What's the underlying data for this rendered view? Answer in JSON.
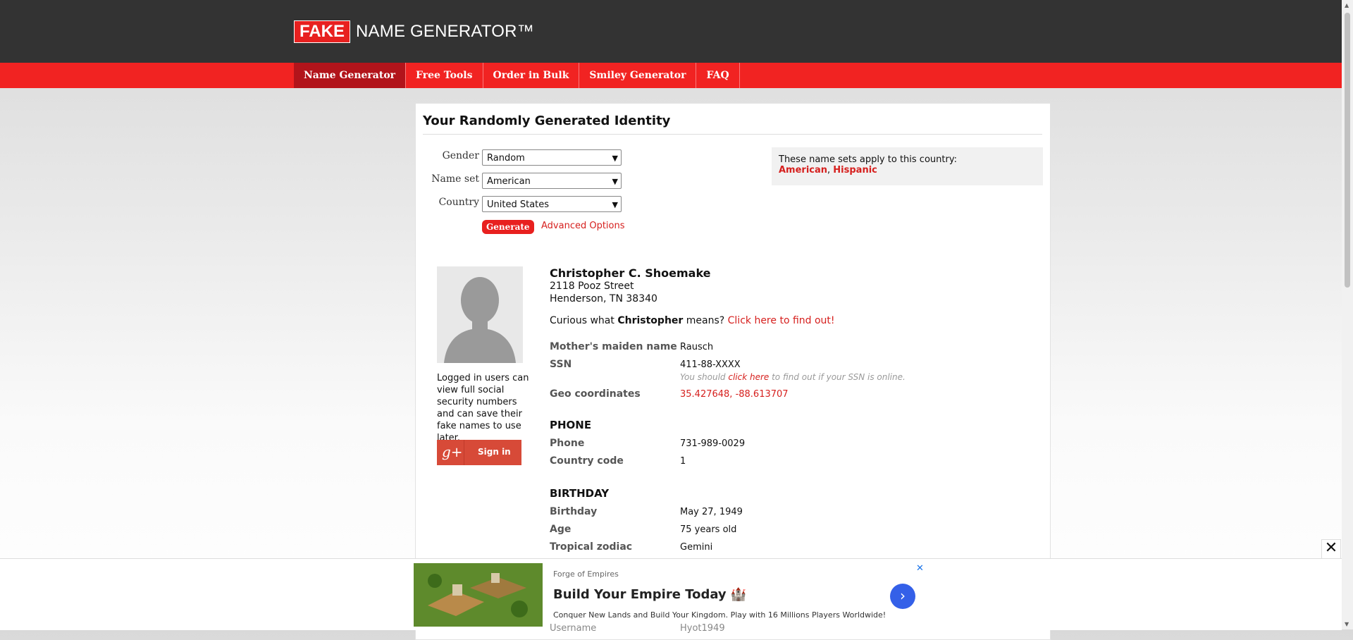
{
  "header": {
    "logo_fake": "FAKE",
    "logo_rest": "NAME GENERATOR™"
  },
  "nav": {
    "items": [
      {
        "label": "Name Generator"
      },
      {
        "label": "Free Tools"
      },
      {
        "label": "Order in Bulk"
      },
      {
        "label": "Smiley Generator"
      },
      {
        "label": "FAQ"
      }
    ]
  },
  "page": {
    "title": "Your Randomly Generated Identity"
  },
  "form": {
    "gender_label": "Gender",
    "gender_value": "Random",
    "nameset_label": "Name set",
    "nameset_value": "American",
    "country_label": "Country",
    "country_value": "United States",
    "generate_label": "Generate",
    "advanced_label": "Advanced Options"
  },
  "country_note": {
    "text": "These name sets apply to this country:",
    "link1": "American",
    "comma": ", ",
    "link2": "Hispanic"
  },
  "sidebar": {
    "login_note": "Logged in users can view full social security numbers and can save their fake names to use later.",
    "gplus_glyph": "g+",
    "signin_label": "Sign in"
  },
  "identity": {
    "name": "Christopher C. Shoemake",
    "street": "2118 Pooz Street",
    "city": "Henderson, TN 38340",
    "curious_prefix": "Curious what ",
    "curious_name": "Christopher",
    "curious_mid": " means? ",
    "curious_link": "Click here to find out!",
    "maiden_label": "Mother's maiden name",
    "maiden_value": "Rausch",
    "ssn_label": "SSN",
    "ssn_value": "411-88-XXXX",
    "ssn_hint_prefix": "You should ",
    "ssn_hint_link": "click here",
    "ssn_hint_suffix": " to find out if your SSN is online.",
    "geo_label": "Geo coordinates",
    "geo_value": "35.427648, -88.613707"
  },
  "phone_section": {
    "heading": "PHONE",
    "phone_label": "Phone",
    "phone_value": "731-989-0029",
    "cc_label": "Country code",
    "cc_value": "1"
  },
  "birthday_section": {
    "heading": "BIRTHDAY",
    "birthday_label": "Birthday",
    "birthday_value": "May 27, 1949",
    "age_label": "Age",
    "age_value": "75 years old",
    "zodiac_label": "Tropical zodiac",
    "zodiac_value": "Gemini"
  },
  "peek": {
    "label": "Username",
    "value": "Hyot1949"
  },
  "ad": {
    "brand": "Forge of Empires",
    "title": "Build Your Empire Today 🏰",
    "desc": "Conquer New Lands and Build Your Kingdom. Play with 16 Millions Players Worldwide!",
    "arrow_glyph": "›",
    "close_glyph": "✕"
  },
  "close_overlay_glyph": "✕"
}
